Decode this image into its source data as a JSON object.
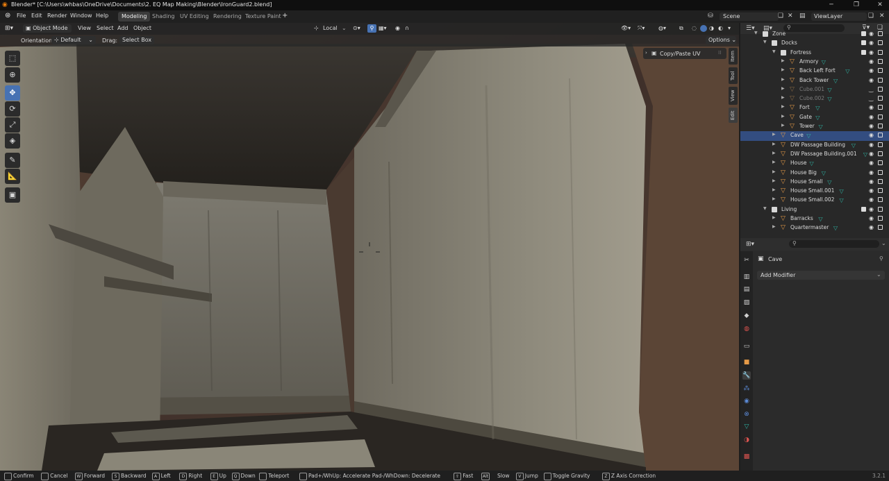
{
  "window": {
    "title": "Blender* [C:\\Users\\whbas\\OneDrive\\Documents\\2. EQ Map Making\\Blender\\IronGuard2.blend]",
    "minimize": "─",
    "maximize": "❐",
    "close": "✕"
  },
  "menubar": {
    "items": [
      "File",
      "Edit",
      "Render",
      "Window",
      "Help"
    ],
    "workspaces": [
      "Modeling",
      "Shading",
      "UV Editing",
      "Rendering",
      "Texture Paint"
    ],
    "active_workspace": "Modeling",
    "add_workspace": "+",
    "scene_label": "Scene",
    "viewlayer_label": "ViewLayer"
  },
  "viewport_header": {
    "mode": "Object Mode",
    "menus": [
      "View",
      "Select",
      "Add",
      "Object"
    ],
    "transform_pivot": "Local"
  },
  "tool_header": {
    "orientation_label": "Orientation:",
    "orientation_value": "Default",
    "drag_label": "Drag:",
    "drag_value": "Select Box",
    "options_label": "Options"
  },
  "sidebar": {
    "panel_title": "Copy/Paste UV",
    "tabs": [
      "Item",
      "Tool",
      "View",
      "Edit"
    ]
  },
  "outliner": {
    "rows": [
      {
        "label": "Zone",
        "indent": 0,
        "kind": "collection",
        "dim": false,
        "selected": false
      },
      {
        "label": "Docks",
        "indent": 1,
        "kind": "collection",
        "dim": false,
        "selected": false
      },
      {
        "label": "Fortress",
        "indent": 2,
        "kind": "collection",
        "dim": false,
        "selected": false
      },
      {
        "label": "Armory",
        "indent": 3,
        "kind": "object",
        "dim": false,
        "selected": false
      },
      {
        "label": "Back Left Fort",
        "indent": 3,
        "kind": "object",
        "dim": false,
        "selected": false
      },
      {
        "label": "Back Tower",
        "indent": 3,
        "kind": "object",
        "dim": false,
        "selected": false
      },
      {
        "label": "Cube.001",
        "indent": 3,
        "kind": "object",
        "dim": true,
        "selected": false
      },
      {
        "label": "Cube.002",
        "indent": 3,
        "kind": "object",
        "dim": true,
        "selected": false
      },
      {
        "label": "Fort",
        "indent": 3,
        "kind": "object",
        "dim": false,
        "selected": false
      },
      {
        "label": "Gate",
        "indent": 3,
        "kind": "object",
        "dim": false,
        "selected": false
      },
      {
        "label": "Tower",
        "indent": 3,
        "kind": "object",
        "dim": false,
        "selected": false
      },
      {
        "label": "Cave",
        "indent": 2,
        "kind": "object",
        "dim": false,
        "selected": true
      },
      {
        "label": "DW Passage Building",
        "indent": 2,
        "kind": "object",
        "dim": false,
        "selected": false
      },
      {
        "label": "DW Passage Building.001",
        "indent": 2,
        "kind": "object",
        "dim": false,
        "selected": false
      },
      {
        "label": "House",
        "indent": 2,
        "kind": "object",
        "dim": false,
        "selected": false
      },
      {
        "label": "House Big",
        "indent": 2,
        "kind": "object",
        "dim": false,
        "selected": false
      },
      {
        "label": "House Small",
        "indent": 2,
        "kind": "object",
        "dim": false,
        "selected": false
      },
      {
        "label": "House Small.001",
        "indent": 2,
        "kind": "object",
        "dim": false,
        "selected": false
      },
      {
        "label": "House Small.002",
        "indent": 2,
        "kind": "object",
        "dim": false,
        "selected": false
      },
      {
        "label": "Living",
        "indent": 1,
        "kind": "collection",
        "dim": false,
        "selected": false
      },
      {
        "label": "Barracks",
        "indent": 2,
        "kind": "object",
        "dim": false,
        "selected": false
      },
      {
        "label": "Quartermaster",
        "indent": 2,
        "kind": "object",
        "dim": false,
        "selected": false
      }
    ]
  },
  "properties": {
    "object_name": "Cave",
    "add_modifier": "Add Modifier"
  },
  "statusbar": {
    "items": [
      {
        "key": "",
        "label": "Confirm"
      },
      {
        "key": "",
        "label": "Cancel"
      },
      {
        "key": "W",
        "label": "Forward"
      },
      {
        "key": "S",
        "label": "Backward"
      },
      {
        "key": "A",
        "label": "Left"
      },
      {
        "key": "D",
        "label": "Right"
      },
      {
        "key": "E",
        "label": "Up"
      },
      {
        "key": "Q",
        "label": "Down"
      },
      {
        "key": "",
        "label": "Teleport"
      },
      {
        "key": "",
        "label": "Pad+/WhUp: Accelerate Pad-/WhDown: Decelerate"
      },
      {
        "key": "⇧",
        "label": "Fast"
      },
      {
        "key": "Alt",
        "label": "Slow"
      },
      {
        "key": "V",
        "label": "Jump"
      },
      {
        "key": "",
        "label": "Toggle Gravity"
      },
      {
        "key": "Z",
        "label": "Z Axis Correction"
      }
    ],
    "version": "3.2.1"
  }
}
